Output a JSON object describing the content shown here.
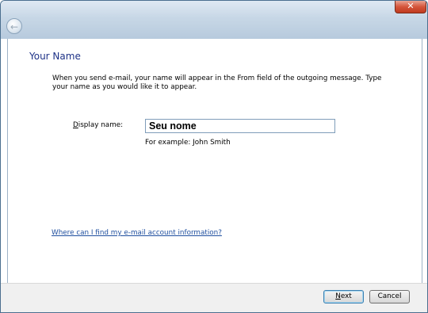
{
  "window": {
    "close_glyph": "✕"
  },
  "nav": {
    "back_glyph": "←"
  },
  "page": {
    "heading": "Your Name",
    "description": "When you send e-mail, your name will appear in the From field of the outgoing message. Type your name as you would like it to appear.",
    "display_name_label_accel": "D",
    "display_name_label_rest": "isplay name:",
    "display_name_value": "Seu nome",
    "example_text": "For example: John Smith",
    "help_link": "Where can I find my e-mail account information?"
  },
  "buttons": {
    "next_accel": "N",
    "next_rest": "ext",
    "cancel": "Cancel"
  },
  "colors": {
    "heading": "#1e3287",
    "link": "#1f4f9f",
    "close": "#c7432a"
  }
}
